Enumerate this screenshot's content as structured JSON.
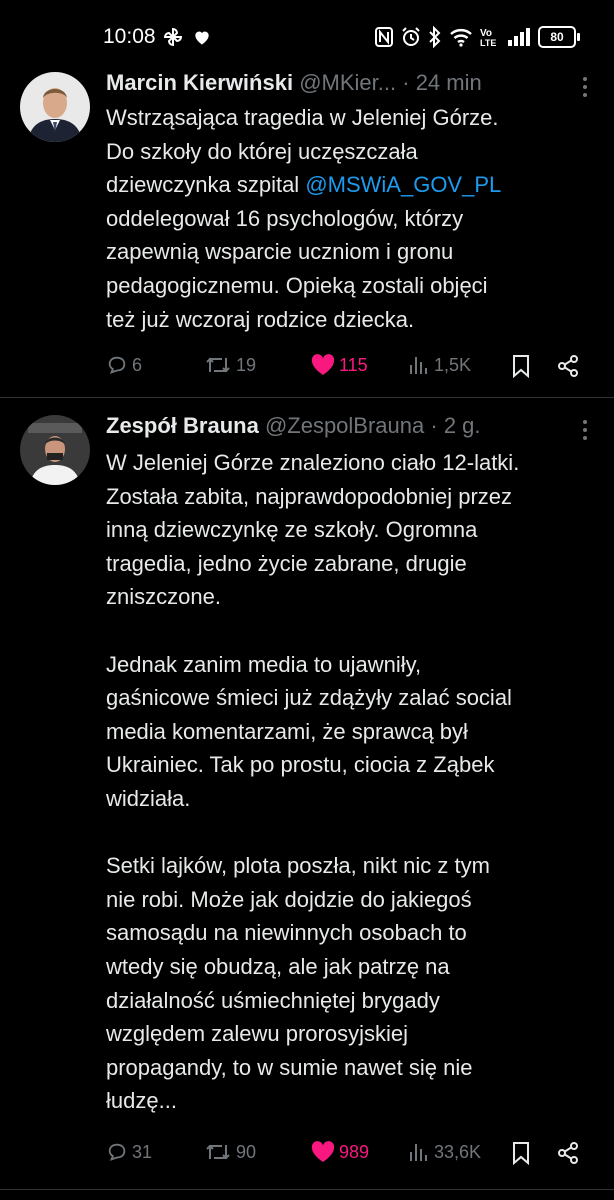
{
  "status_bar": {
    "time": "10:08",
    "battery": "80",
    "icons": [
      "pinwheel-icon",
      "heart-icon",
      "nfc-icon",
      "alarm-icon",
      "bluetooth-icon",
      "wifi-icon",
      "volte-icon",
      "signal-icon",
      "battery-icon"
    ]
  },
  "tweets": [
    {
      "name": "Marcin Kierwiński",
      "handle": "@MKier...",
      "dot": "·",
      "time": "24 min",
      "text_before": "Wstrząsająca tragedia w Jeleniej Górze.\nDo szkoły do której uczęszczała\ndziewczynka szpital ",
      "mention": "@MSWiA_GOV_PL",
      "text_after": "\noddelegował 16 psychologów, którzy\nzapewnią wsparcie uczniom i gronu\npedagogicznemu. Opieką zostali objęci\nteż już wczoraj rodzice dziecka.",
      "replies": "6",
      "reposts": "19",
      "likes": "115",
      "views": "1,5K"
    },
    {
      "name": "Zespół Brauna",
      "handle": "@ZespolBrauna",
      "dot": "·",
      "time": "2 g.",
      "text": "W Jeleniej Górze znaleziono ciało 12-latki.\nZostała zabita, najprawdopodobniej przez\ninną dziewczynkę ze szkoły. Ogromna\ntragedia, jedno życie zabrane, drugie\nzniszczone.\n\nJednak zanim media to ujawniły,\ngaśnicowe śmieci już zdążyły zalać social\nmedia komentarzami, że sprawcą był\nUkrainiec. Tak po prostu, ciocia z Ząbek\nwidziała.\n\nSetki lajków, plota poszła, nikt nic z tym\nnie robi. Może jak dojdzie do jakiegoś\nsamosądu na niewinnych osobach to\nwtedy się obudzą, ale jak patrzę na\ndziałalność uśmiechniętej brygady\nwzględem zalewu prorosyjskiej\npropagandy, to w sumie nawet się nie\nłudzę...",
      "replies": "31",
      "reposts": "90",
      "likes": "989",
      "views": "33,6K"
    }
  ],
  "colors": {
    "background": "#000000",
    "text": "#e7e9ea",
    "muted": "#71767b",
    "link": "#1d9bf0",
    "like": "#f91880",
    "divider": "#2f3336"
  }
}
